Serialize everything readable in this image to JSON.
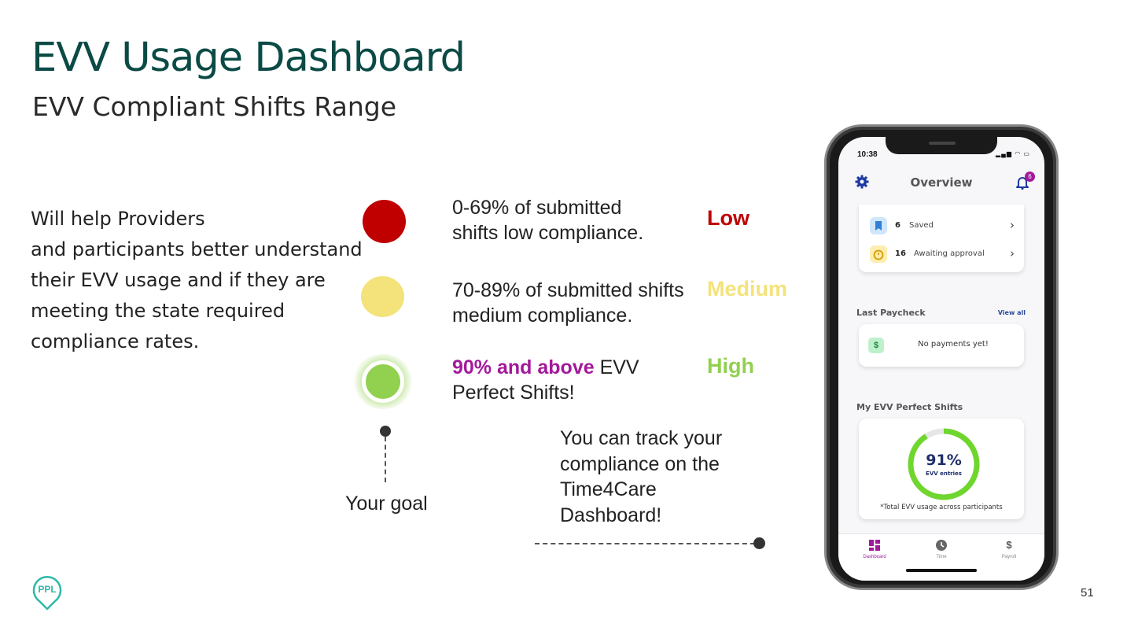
{
  "header": {
    "title": "EVV Usage Dashboard",
    "subtitle": "EVV Compliant Shifts Range"
  },
  "intro_lines": [
    "Will help Providers",
    "and participants better understand",
    "their EVV usage and if they are",
    "meeting the state required",
    "compliance rates."
  ],
  "ranges": {
    "low": {
      "lines": [
        "0-69% of submitted",
        "shifts low compliance."
      ],
      "level": "Low",
      "color": "#c00000"
    },
    "medium": {
      "lines": [
        "70-89% of submitted shifts",
        "medium compliance."
      ],
      "level": "Medium",
      "color": "#f3e37a"
    },
    "high": {
      "accent": "90% and above",
      "rest": " EVV",
      "line2": "Perfect Shifts!",
      "level": "High",
      "color": "#92d050",
      "accent_color": "#a3199b"
    }
  },
  "goal": {
    "label": "Your goal"
  },
  "track": {
    "lines": [
      "You can track your",
      "compliance on the",
      "Time4Care",
      "Dashboard!"
    ]
  },
  "page_number": "51",
  "phone": {
    "time": "10:38",
    "header_title": "Overview",
    "bell_badge": "6",
    "saved": {
      "count": "6",
      "label": "Saved"
    },
    "awaiting": {
      "count": "16",
      "label": "Awaiting approval"
    },
    "last_paycheck": {
      "title": "Last Paycheck",
      "view_all": "View all",
      "message": "No payments yet!",
      "icon": "$"
    },
    "perfect_shifts": {
      "title": "My EVV Perfect Shifts",
      "percent": "91%",
      "percent_value": 0.91,
      "sub": "EVV entries",
      "note": "*Total EVV usage across participants"
    },
    "tabs": [
      {
        "label": "Dashboard",
        "icon": "dashboard-icon"
      },
      {
        "label": "Time",
        "icon": "clock-icon"
      },
      {
        "label": "Payroll",
        "icon": "dollar-icon"
      }
    ],
    "payroll_symbol": "$"
  }
}
